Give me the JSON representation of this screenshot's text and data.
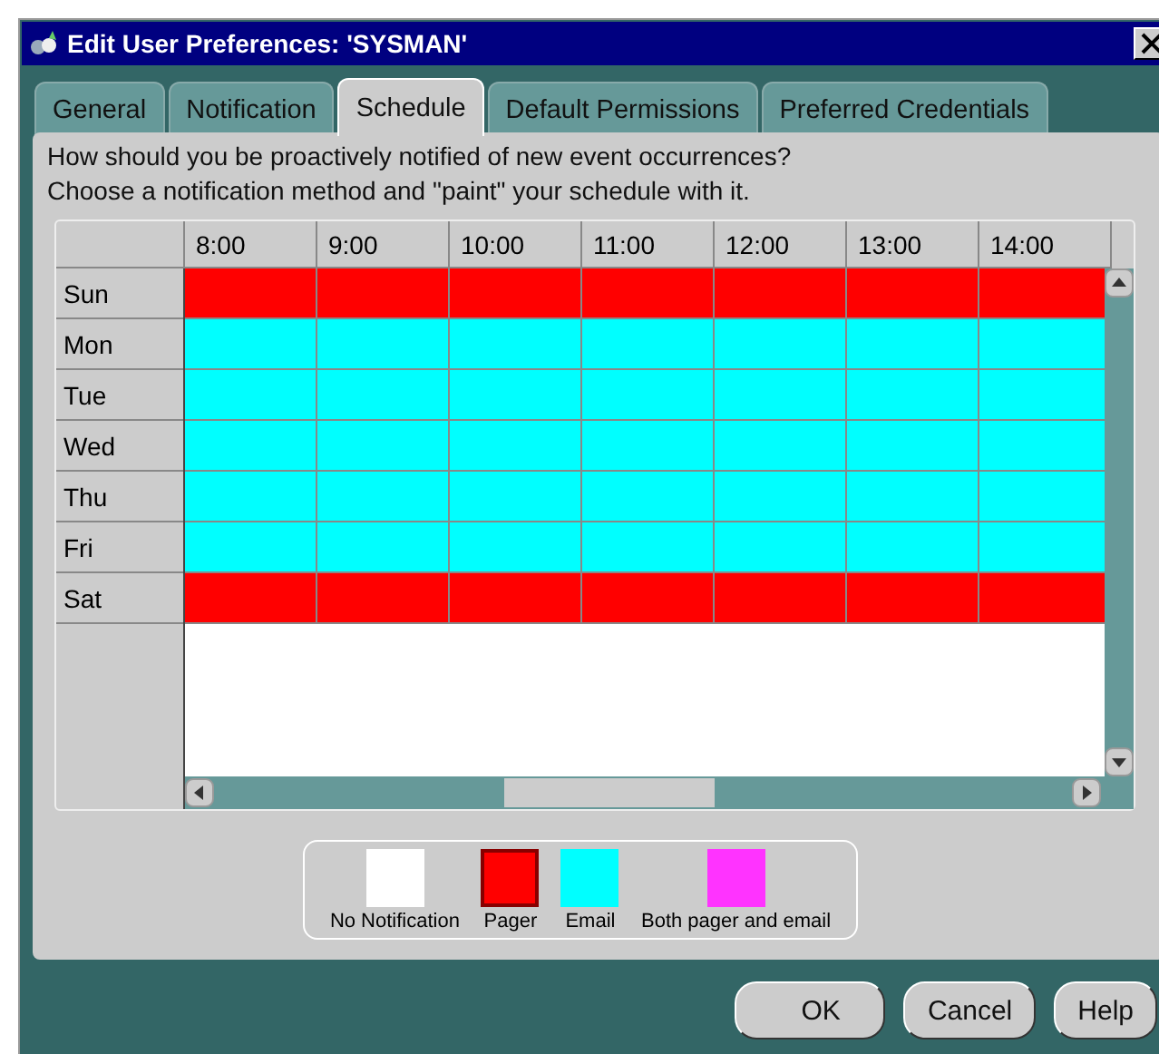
{
  "window": {
    "title": "Edit User Preferences: 'SYSMAN'"
  },
  "tabs": [
    {
      "label": "General",
      "selected": false
    },
    {
      "label": "Notification",
      "selected": false
    },
    {
      "label": "Schedule",
      "selected": true
    },
    {
      "label": "Default Permissions",
      "selected": false
    },
    {
      "label": "Preferred Credentials",
      "selected": false
    }
  ],
  "instructions": [
    "How should you be proactively notified of new event occurrences?",
    "Choose a notification method and \"paint\" your schedule with it."
  ],
  "schedule": {
    "hours": [
      "8:00",
      "9:00",
      "10:00",
      "11:00",
      "12:00",
      "13:00",
      "14:00"
    ],
    "rows": [
      {
        "day": "Sun",
        "color": "#ff0000"
      },
      {
        "day": "Mon",
        "color": "#00ffff"
      },
      {
        "day": "Tue",
        "color": "#00ffff"
      },
      {
        "day": "Wed",
        "color": "#00ffff"
      },
      {
        "day": "Thu",
        "color": "#00ffff"
      },
      {
        "day": "Fri",
        "color": "#00ffff"
      },
      {
        "day": "Sat",
        "color": "#ff0000"
      }
    ]
  },
  "legend": [
    {
      "label": "No Notification",
      "color": "#ffffff",
      "selected": false
    },
    {
      "label": "Pager",
      "color": "#ff0000",
      "selected": true
    },
    {
      "label": "Email",
      "color": "#00ffff",
      "selected": false
    },
    {
      "label": "Both pager and email",
      "color": "#ff33ff",
      "selected": false
    }
  ],
  "buttons": [
    "OK",
    "Cancel",
    "Help"
  ]
}
